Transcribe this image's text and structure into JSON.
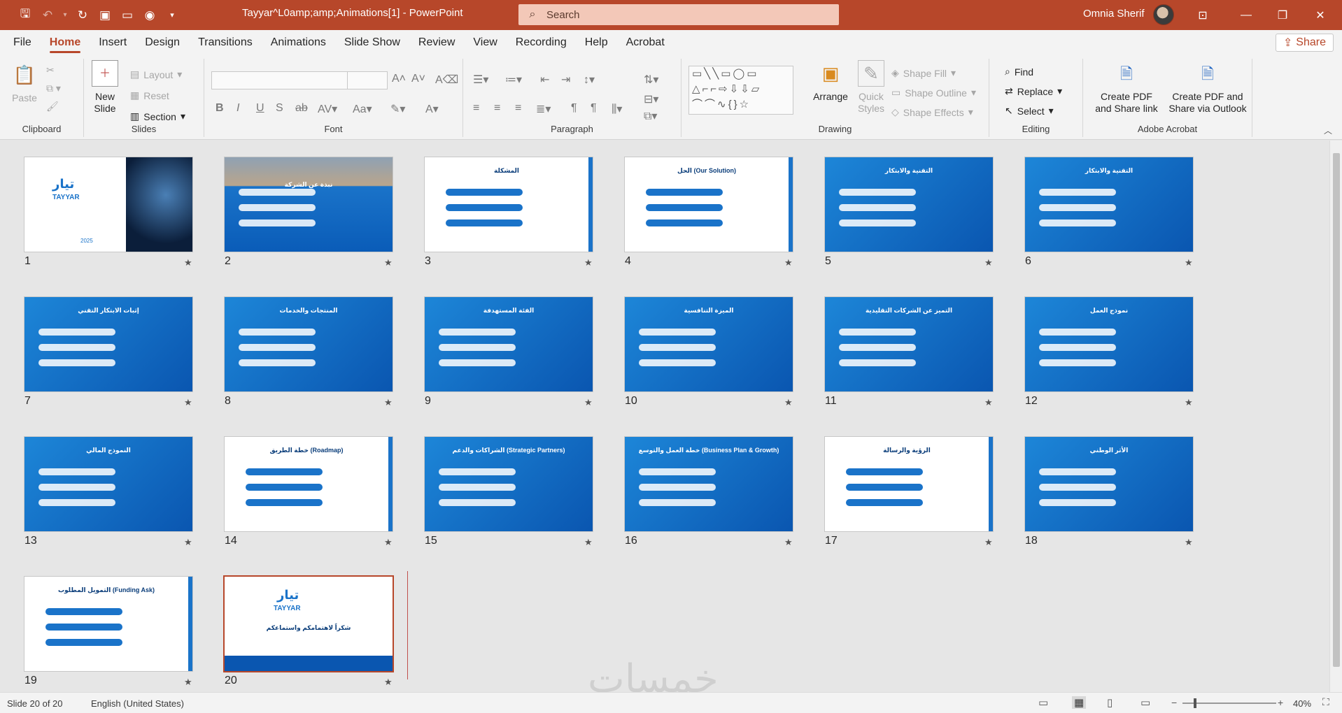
{
  "titlebar": {
    "doc_title": "Tayyar^L0amp;amp;Animations[1]  -  PowerPoint",
    "search_placeholder": "Search",
    "user_name": "Omnia Sherif"
  },
  "menu": {
    "tabs": [
      "File",
      "Home",
      "Insert",
      "Design",
      "Transitions",
      "Animations",
      "Slide Show",
      "Review",
      "View",
      "Recording",
      "Help",
      "Acrobat"
    ],
    "active": "Home",
    "share_label": "Share"
  },
  "ribbon": {
    "clipboard": {
      "label": "Clipboard",
      "paste": "Paste"
    },
    "slides": {
      "label": "Slides",
      "new_slide_1": "New",
      "new_slide_2": "Slide",
      "layout": "Layout",
      "reset": "Reset",
      "section": "Section"
    },
    "font": {
      "label": "Font"
    },
    "paragraph": {
      "label": "Paragraph"
    },
    "drawing": {
      "label": "Drawing",
      "arrange": "Arrange",
      "quick_styles_1": "Quick",
      "quick_styles_2": "Styles",
      "shape_fill": "Shape Fill",
      "shape_outline": "Shape Outline",
      "shape_effects": "Shape Effects"
    },
    "editing": {
      "label": "Editing",
      "find": "Find",
      "replace": "Replace",
      "select": "Select"
    },
    "acrobat": {
      "label": "Adobe Acrobat",
      "create_link_1": "Create PDF",
      "create_link_2": "and Share link",
      "create_outlook_1": "Create PDF and",
      "create_outlook_2": "Share via Outlook"
    }
  },
  "slides": [
    {
      "n": "1",
      "title": "",
      "theme": "intro"
    },
    {
      "n": "2",
      "title": "نبذة عن الشركة",
      "theme": "photo"
    },
    {
      "n": "3",
      "title": "المشكلة",
      "theme": "white"
    },
    {
      "n": "4",
      "title": "الحل (Our Solution)",
      "theme": "white"
    },
    {
      "n": "5",
      "title": "التقنية والابتكار",
      "theme": "blue"
    },
    {
      "n": "6",
      "title": "التقنية والابتكار",
      "theme": "blue"
    },
    {
      "n": "7",
      "title": "إثبات الابتكار التقني",
      "theme": "blue"
    },
    {
      "n": "8",
      "title": "المنتجات والخدمات",
      "theme": "blue"
    },
    {
      "n": "9",
      "title": "الفئة المستهدفة",
      "theme": "blue"
    },
    {
      "n": "10",
      "title": "الميزة التنافسية",
      "theme": "blue"
    },
    {
      "n": "11",
      "title": "التميز عن الشركات التقليدية",
      "theme": "blue"
    },
    {
      "n": "12",
      "title": "نموذج العمل",
      "theme": "blue"
    },
    {
      "n": "13",
      "title": "النموذج المالي",
      "theme": "blue"
    },
    {
      "n": "14",
      "title": "خطة الطريق (Roadmap)",
      "theme": "white"
    },
    {
      "n": "15",
      "title": "الشراكات والدعم (Strategic Partners)",
      "theme": "blue"
    },
    {
      "n": "16",
      "title": "خطة العمل والتوسع (Business Plan & Growth)",
      "theme": "blue"
    },
    {
      "n": "17",
      "title": "الرؤية والرسالة",
      "theme": "white"
    },
    {
      "n": "18",
      "title": "الأثر الوطني",
      "theme": "blue"
    },
    {
      "n": "19",
      "title": "التمويل المطلوب (Funding Ask)",
      "theme": "white"
    },
    {
      "n": "20",
      "title": "شكراً لاهتمامكم واستماعكم",
      "theme": "end"
    }
  ],
  "slide1": {
    "brand_ar": "تيار",
    "brand_en": "TAYYAR",
    "year": "2025"
  },
  "slide20": {
    "brand_ar": "تيار",
    "brand_en": "TAYYAR"
  },
  "status": {
    "slide_info": "Slide 20 of 20",
    "language": "English (United States)",
    "zoom": "40%"
  },
  "watermark": "خمسات",
  "colors": {
    "accent": "#b7472a",
    "slide_blue": "#1a73c9"
  }
}
